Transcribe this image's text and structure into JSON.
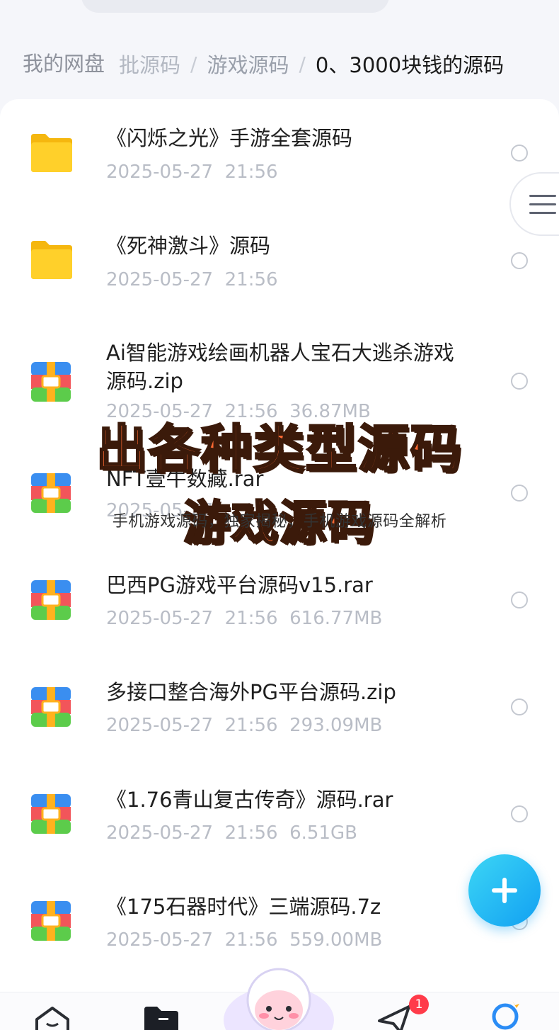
{
  "breadcrumb": {
    "root": "我的网盘",
    "items": [
      "批源码",
      "游戏源码",
      "0、3000块钱的源码"
    ]
  },
  "files": [
    {
      "name": "《闪烁之光》手游全套源码",
      "date": "2025-05-27",
      "time": "21:56",
      "size": "",
      "type": "folder"
    },
    {
      "name": "《死神激斗》源码",
      "date": "2025-05-27",
      "time": "21:56",
      "size": "",
      "type": "folder"
    },
    {
      "name": "Ai智能游戏绘画机器人宝石大逃杀游戏源码.zip",
      "date": "2025-05-27",
      "time": "21:56",
      "size": "36.87MB",
      "type": "archive"
    },
    {
      "name": "NFT壹牛数藏.rar",
      "date": "2025-05-27",
      "time": "",
      "size": "",
      "type": "archive"
    },
    {
      "name": "巴西PG游戏平台源码v15.rar",
      "date": "2025-05-27",
      "time": "21:56",
      "size": "616.77MB",
      "type": "archive"
    },
    {
      "name": "多接口整合海外PG平台源码.zip",
      "date": "2025-05-27",
      "time": "21:56",
      "size": "293.09MB",
      "type": "archive"
    },
    {
      "name": "《1.76青山复古传奇》源码.rar",
      "date": "2025-05-27",
      "time": "21:56",
      "size": "6.51GB",
      "type": "archive"
    },
    {
      "name": "《175石器时代》三端源码.7z",
      "date": "2025-05-27",
      "time": "21:56",
      "size": "559.00MB",
      "type": "archive"
    }
  ],
  "overlay": {
    "line1": "出各种类型源码",
    "line2": "游戏源码",
    "caption": "手机游戏源码，独家揭秘，手机游戏源码全解析"
  },
  "bottom_nav": {
    "badge": "1",
    "icons": [
      "home-icon",
      "files-icon",
      "mascot-icon",
      "send-icon",
      "profile-icon"
    ]
  },
  "colors": {
    "accent": "#12a0f2",
    "folder": "#ffc61a",
    "overlay_text": "#ff6a33"
  }
}
